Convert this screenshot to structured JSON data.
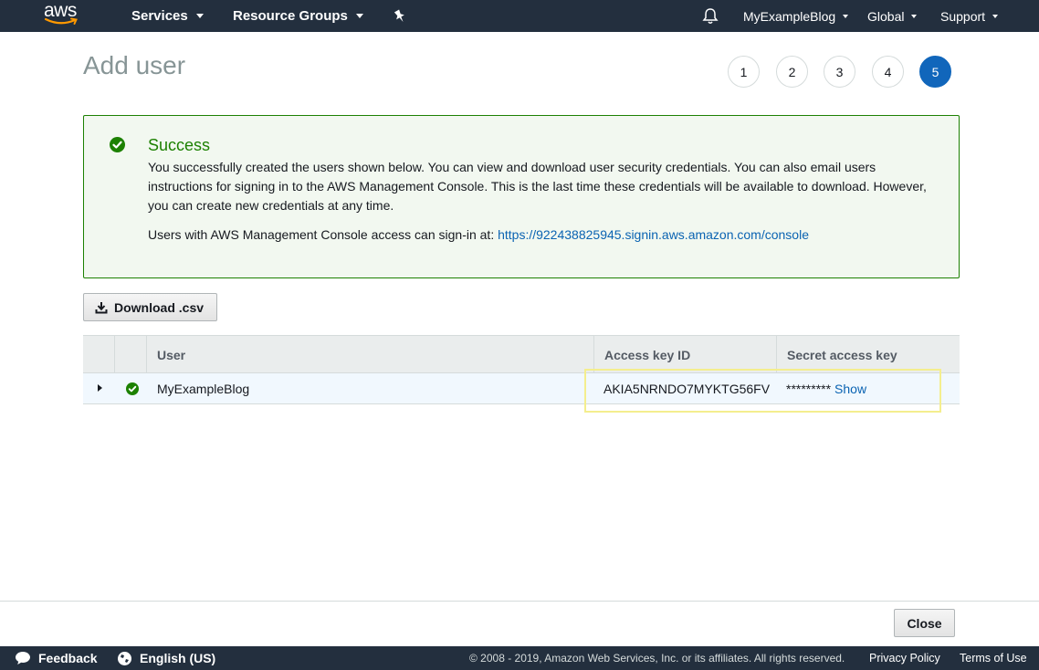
{
  "topnav": {
    "logo_text": "aws",
    "services": "Services",
    "resource_groups": "Resource Groups",
    "account": "MyExampleBlog",
    "region": "Global",
    "support": "Support"
  },
  "page": {
    "title": "Add user"
  },
  "steps": [
    {
      "label": "1",
      "active": false
    },
    {
      "label": "2",
      "active": false
    },
    {
      "label": "3",
      "active": false
    },
    {
      "label": "4",
      "active": false
    },
    {
      "label": "5",
      "active": true
    }
  ],
  "success": {
    "title": "Success",
    "message": "You successfully created the users shown below. You can view and download user security credentials. You can also email users instructions for signing in to the AWS Management Console. This is the last time these credentials will be available to download. However, you can create new credentials at any time.",
    "signin_prefix": "Users with AWS Management Console access can sign-in at: ",
    "signin_url": "https://922438825945.signin.aws.amazon.com/console"
  },
  "download_button": "Download .csv",
  "table": {
    "headers": {
      "user": "User",
      "access_key_id": "Access key ID",
      "secret_access_key": "Secret access key"
    },
    "rows": [
      {
        "user": "MyExampleBlog",
        "access_key_id": "AKIA5NRNDO7MYKTG56FV",
        "secret_masked": "*********",
        "show_label": "Show"
      }
    ]
  },
  "close_button": "Close",
  "footer": {
    "feedback": "Feedback",
    "language": "English (US)",
    "copyright": "© 2008 - 2019, Amazon Web Services, Inc. or its affiliates. All rights reserved.",
    "privacy": "Privacy Policy",
    "terms": "Terms of Use"
  },
  "colors": {
    "nav_bg": "#232f3e",
    "success_green": "#1d8102",
    "link_blue": "#0a63b2",
    "active_step": "#1166bb",
    "highlight": "#f4ee8e"
  }
}
